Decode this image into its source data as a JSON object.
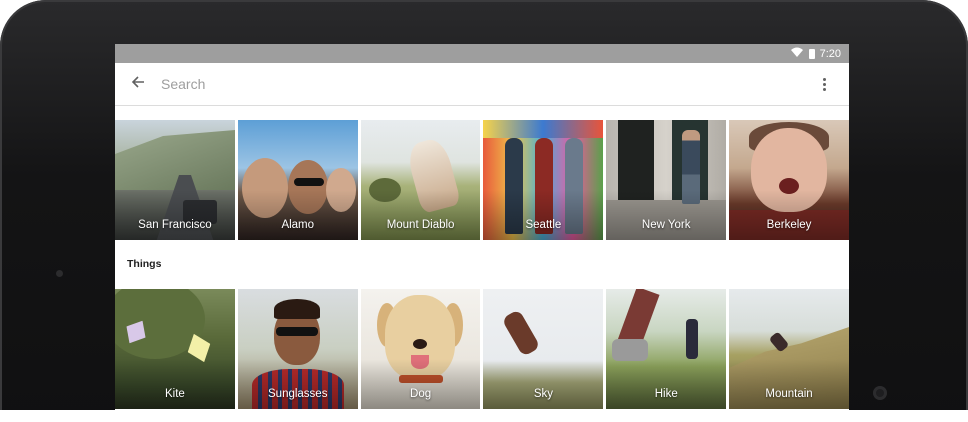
{
  "status_bar": {
    "time": "7:20"
  },
  "search": {
    "placeholder": "Search",
    "value": ""
  },
  "places": [
    {
      "label": "San Francisco"
    },
    {
      "label": "Alamo"
    },
    {
      "label": "Mount Diablo"
    },
    {
      "label": "Seattle"
    },
    {
      "label": "New York"
    },
    {
      "label": "Berkeley"
    }
  ],
  "things": {
    "title": "Things",
    "items": [
      {
        "label": "Kite"
      },
      {
        "label": "Sunglasses"
      },
      {
        "label": "Dog"
      },
      {
        "label": "Sky"
      },
      {
        "label": "Hike"
      },
      {
        "label": "Mountain"
      }
    ]
  },
  "icons": {
    "back": "arrow-back-icon",
    "overflow": "more-vert-icon",
    "wifi": "wifi-icon",
    "battery": "battery-icon"
  },
  "colors": {
    "status_bar": "#9e9e9e",
    "bezel": "#141415",
    "divider": "#dcdcdc"
  }
}
